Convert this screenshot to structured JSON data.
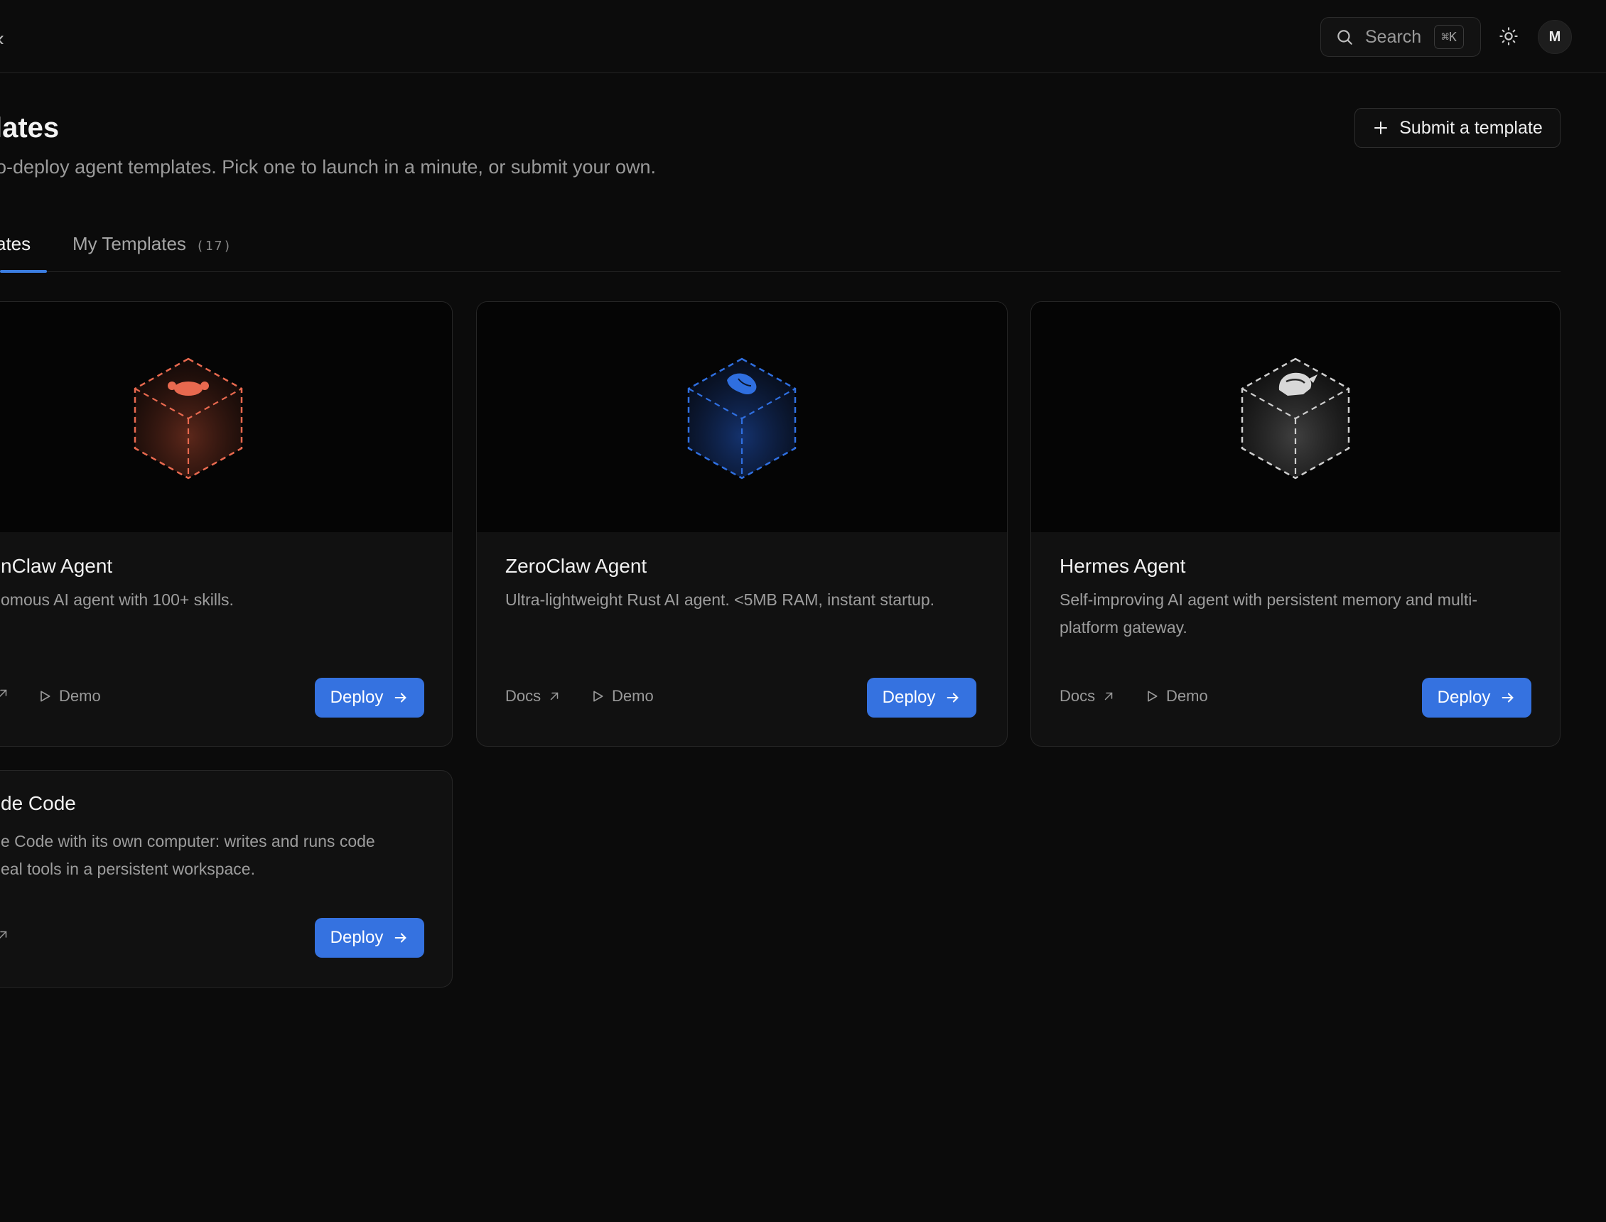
{
  "topbar": {
    "left_glyph": "‹",
    "search": {
      "label": "Search",
      "shortcut": "⌘K",
      "icon": "search-icon"
    },
    "theme_icon": "sun-icon",
    "avatar_initial": "M"
  },
  "header": {
    "title": "lates",
    "subtitle": "o-deploy agent templates. Pick one to launch in a minute, or submit your own.",
    "submit_label": "Submit a template"
  },
  "tabs": [
    {
      "label": "ates",
      "active": true
    },
    {
      "label": "My Templates",
      "count": "(17)",
      "active": false
    }
  ],
  "templates": [
    {
      "name": "nClaw Agent",
      "description": "omous AI agent with 100+ skills.",
      "docs": "",
      "demo": "Demo",
      "deploy": "Deploy",
      "color": "#e8694f",
      "icon": "crab-icon"
    },
    {
      "name": "ZeroClaw Agent",
      "description": "Ultra-lightweight Rust AI agent. <5MB RAM, instant startup.",
      "docs": "Docs",
      "demo": "Demo",
      "deploy": "Deploy",
      "color": "#2f6fe0",
      "icon": "lobster-icon"
    },
    {
      "name": "Hermes Agent",
      "description_line1": "Self-improving AI agent with persistent memory and multi-",
      "description_line2": "platform gateway.",
      "docs": "Docs",
      "demo": "Demo",
      "deploy": "Deploy",
      "color": "#cfcfcf",
      "icon": "hermes-helmet-icon"
    },
    {
      "name": "de Code",
      "description_line1": "e Code with its own computer: writes and runs code",
      "description_line2": "eal tools in a persistent workspace.",
      "deploy": "Deploy"
    }
  ],
  "accent": "#3572e0"
}
